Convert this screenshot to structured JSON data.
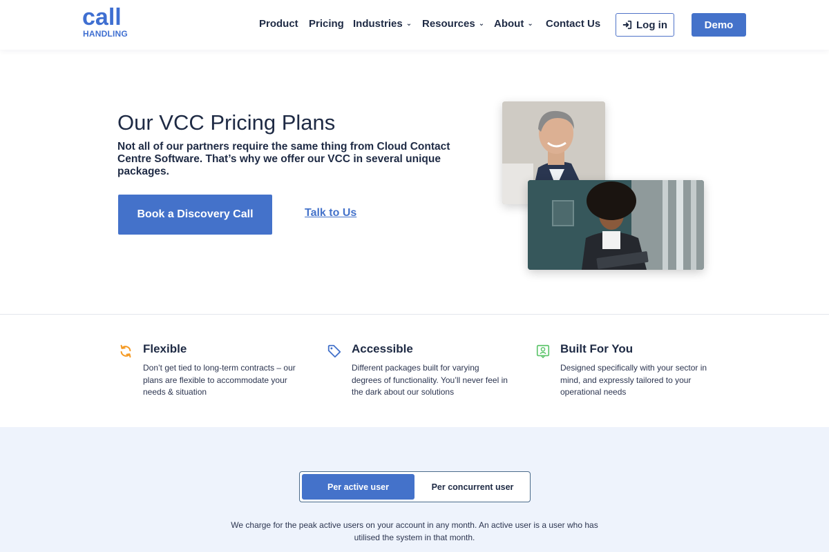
{
  "brand": {
    "logo_top": "call",
    "logo_bottom": "HANDLING",
    "color": "#3f6fd1"
  },
  "nav": {
    "items": [
      {
        "label": "Product",
        "dropdown": false
      },
      {
        "label": "Pricing",
        "dropdown": false
      },
      {
        "label": "Industries",
        "dropdown": true
      },
      {
        "label": "Resources",
        "dropdown": true
      },
      {
        "label": "About",
        "dropdown": true
      },
      {
        "label": "Contact Us",
        "dropdown": false
      }
    ],
    "login_label": "Log in",
    "login_icon": "sign-in-icon",
    "demo_label": "Demo"
  },
  "hero": {
    "title": "Our VCC Pricing Plans",
    "subtitle": "Not all of our partners require the same thing from Cloud Contact Centre Software. That’s why we offer our VCC in several unique packages.",
    "cta_label": "Book a Discovery Call",
    "link_label": "Talk to Us"
  },
  "features": [
    {
      "icon": "refresh-icon",
      "icon_color": "#f59a23",
      "title": "Flexible",
      "desc": "Don’t get tied to long-term contracts – our plans are flexible to accommodate your needs & situation"
    },
    {
      "icon": "tag-icon",
      "icon_color": "#4472ca",
      "title": "Accessible",
      "desc": "Different packages built for varying degrees of functionality. You’ll never feel in the dark about our solutions"
    },
    {
      "icon": "user-badge-icon",
      "icon_color": "#5cc46a",
      "title": "Built For You",
      "desc": "Designed specifically with your sector in mind, and expressly tailored to your operational needs"
    }
  ],
  "pricing": {
    "toggle": {
      "active_label": "Per active user",
      "other_label": "Per concurrent user"
    },
    "charge_text": "We charge for the peak active users on your account in any month. An active user is a user who has utilised the system in that month."
  },
  "colors": {
    "accent": "#4472ca",
    "text": "#1e2a44",
    "band": "#eef3fc"
  }
}
